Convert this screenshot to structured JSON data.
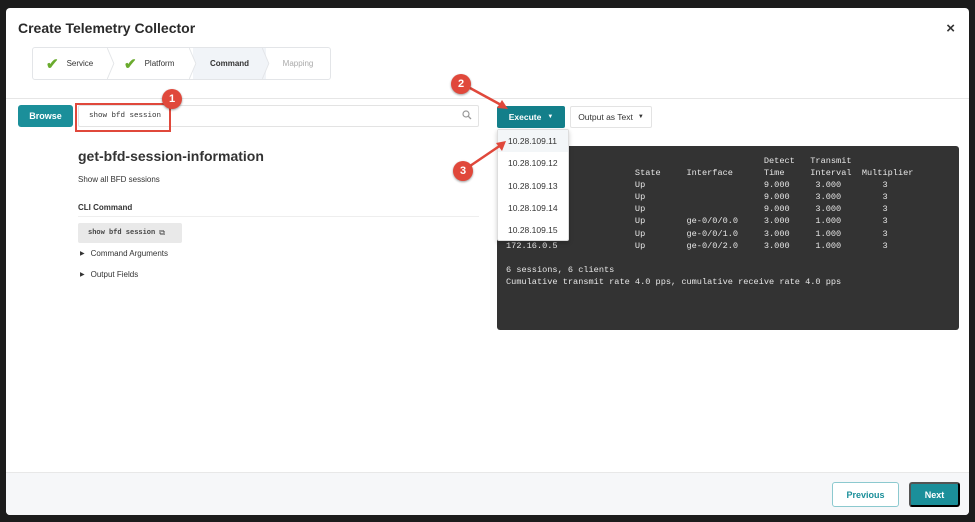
{
  "dialog": {
    "title": "Create Telemetry Collector",
    "close_icon": "×"
  },
  "steps": [
    {
      "label": "Service",
      "done": true
    },
    {
      "label": "Platform",
      "done": true
    },
    {
      "label": "Command",
      "active": true
    },
    {
      "label": "Mapping"
    }
  ],
  "browse_label": "Browse",
  "search": {
    "value": "show bfd session"
  },
  "command": {
    "name": "get-bfd-session-information",
    "description": "Show all BFD sessions",
    "cli_heading": "CLI Command",
    "cli_value": "show bfd session",
    "sections": [
      "Command Arguments",
      "Output Fields"
    ]
  },
  "execute_label": "Execute",
  "output_label": "Output as Text",
  "hosts": [
    "10.28.109.11",
    "10.28.109.12",
    "10.28.109.13",
    "10.28.109.14",
    "10.28.109.15"
  ],
  "terminal_lines": [
    "                                                  Detect   Transmit",
    "                         State     Interface      Time     Interval  Multiplier",
    "                         Up                       9.000     3.000        3",
    "                         Up                       9.000     3.000        3",
    "                         Up                       9.000     3.000        3",
    "                         Up        ge-0/0/0.0     3.000     1.000        3",
    "                         Up        ge-0/0/1.0     3.000     1.000        3",
    "172.16.0.5               Up        ge-0/0/2.0     3.000     1.000        3",
    "",
    "6 sessions, 6 clients",
    "Cumulative transmit rate 4.0 pps, cumulative receive rate 4.0 pps"
  ],
  "footer": {
    "previous": "Previous",
    "next": "Next"
  },
  "annotations": [
    "1",
    "2",
    "3"
  ],
  "colors": {
    "accent": "#1b8f9a",
    "annotation": "#e0483b",
    "terminal": "#333333"
  }
}
